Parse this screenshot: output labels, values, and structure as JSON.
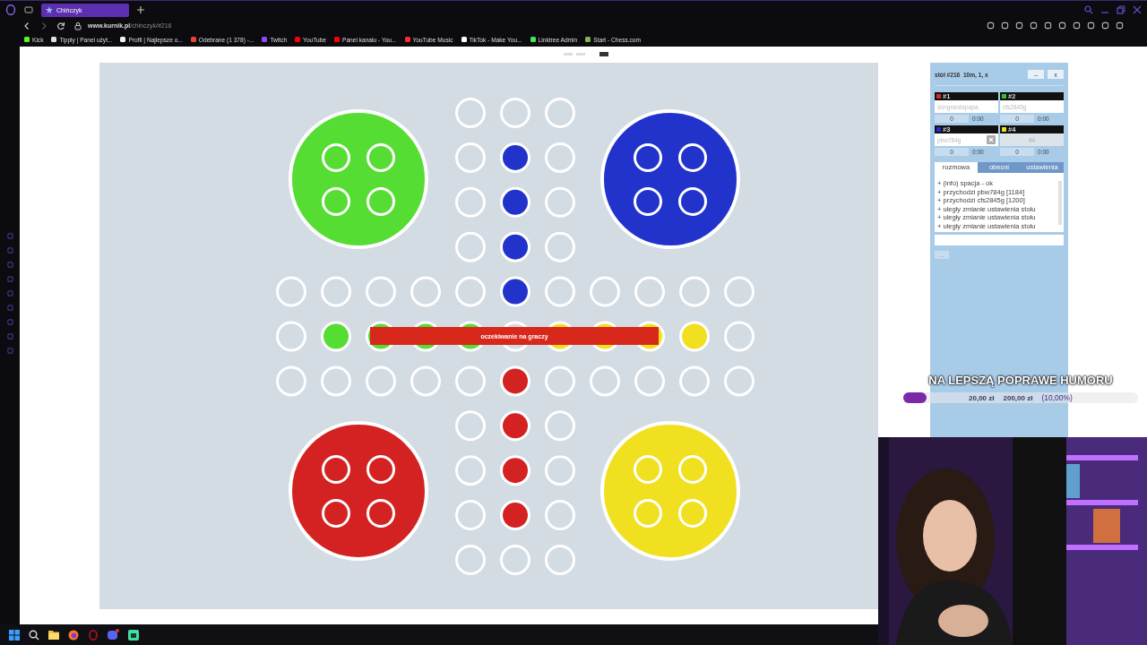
{
  "browser": {
    "tab": {
      "title": "Chińczyk",
      "selected": true
    },
    "url_host": "www.kurnik.pl",
    "url_path": "/chinczyk/#216",
    "bookmarks": [
      {
        "label": "Kick",
        "color": "#53fc18"
      },
      {
        "label": "Tipply | Panel użyt...",
        "color": "#e0e0e0"
      },
      {
        "label": "Profil | Najlepsze o...",
        "color": "#f0f0f0"
      },
      {
        "label": "Odebrane (1 378) -...",
        "color": "#ea4335"
      },
      {
        "label": "Twitch",
        "color": "#9146ff"
      },
      {
        "label": "YouTube",
        "color": "#ff0000"
      },
      {
        "label": "Panel kanału - You...",
        "color": "#ff0000"
      },
      {
        "label": "YouTube Music",
        "color": "#ff2a2a"
      },
      {
        "label": "TikTok - Make You...",
        "color": "#ffffff"
      },
      {
        "label": "Linktree Admin",
        "color": "#43e660"
      },
      {
        "label": "Start - Chess.com",
        "color": "#81b64c"
      }
    ]
  },
  "board": {
    "status": "oczekiwanie na graczy"
  },
  "panel": {
    "title": "stół #216",
    "settings": "10m, 1, x",
    "minimize": "–",
    "close": "x",
    "players": [
      {
        "number": "#1",
        "color": "#d42a2a",
        "name": "dongrandepapa.",
        "score": "0",
        "time": "0:00",
        "empty": false,
        "removable": false
      },
      {
        "number": "#2",
        "color": "#2ec22e",
        "name": "cfs2845g",
        "score": "0",
        "time": "0:00",
        "empty": false,
        "removable": false
      },
      {
        "number": "#3",
        "color": "#2a2ad4",
        "name": "pbw784g",
        "score": "0",
        "time": "0:00",
        "empty": false,
        "removable": true
      },
      {
        "number": "#4",
        "color": "#e8e020",
        "name": "#4",
        "score": "0",
        "time": "0:00",
        "empty": true,
        "removable": false
      }
    ],
    "tabs": [
      {
        "label": "rozmowa",
        "selected": true
      },
      {
        "label": "obecni",
        "selected": false
      },
      {
        "label": "ustawienia",
        "selected": false
      }
    ],
    "chat": [
      "+ (info) spacja - ok",
      "+ przychodzi pbw784g [1184]",
      "+ przychodzi cfs2845g [1200]",
      "+ uległy zmianie ustawienia stołu",
      "+ uległy zmianie ustawienia stołu",
      "+ uległy zmianie ustawienia stołu"
    ],
    "more": "..."
  },
  "goal": {
    "title": "NA LEPSZĄ POPRAWE HUMORU",
    "current": "20,00 zł",
    "target": "200,00 zł",
    "percent": "(10,00%)",
    "level": 0.1
  }
}
